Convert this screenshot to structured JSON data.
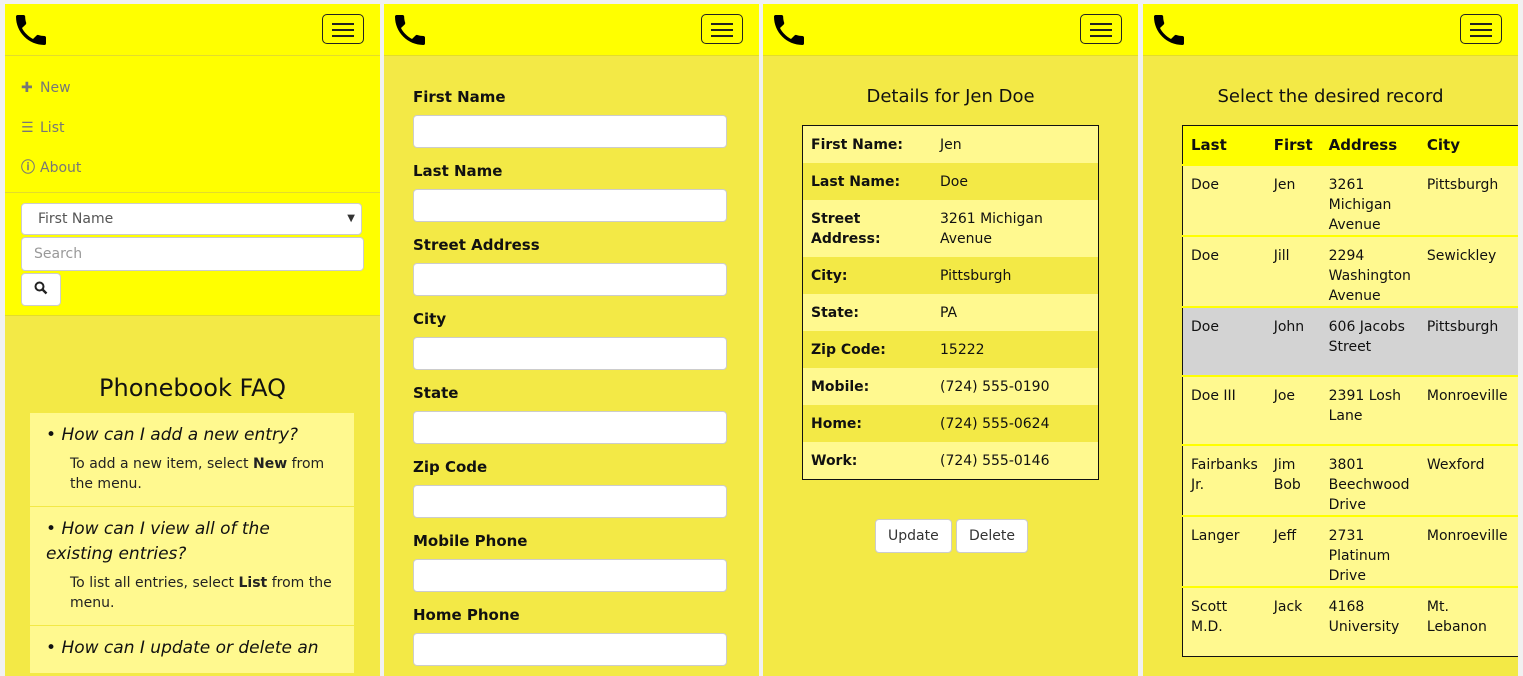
{
  "menu": {
    "items": [
      {
        "icon": "plus-icon",
        "label": "New"
      },
      {
        "icon": "list-icon",
        "label": "List"
      },
      {
        "icon": "info-icon",
        "label": "About"
      }
    ],
    "search_field": "First Name",
    "search_placeholder": "Search"
  },
  "faq": {
    "title": "Phonebook FAQ",
    "items": [
      {
        "q": "How can I add a new entry?",
        "a_pre": "To add a new item, select ",
        "a_bold": "New",
        "a_post": " from the menu."
      },
      {
        "q": "How can I view all of the existing entries?",
        "a_pre": "To list all entries, select ",
        "a_bold": "List",
        "a_post": " from the menu."
      },
      {
        "q": "How can I update or delete an"
      }
    ]
  },
  "form": {
    "labels": [
      "First Name",
      "Last Name",
      "Street Address",
      "City",
      "State",
      "Zip Code",
      "Mobile Phone",
      "Home Phone"
    ]
  },
  "details": {
    "title": "Details for Jen Doe",
    "rows": [
      {
        "k": "First Name:",
        "v": "Jen"
      },
      {
        "k": "Last Name:",
        "v": "Doe"
      },
      {
        "k": "Street Address:",
        "v": "3261 Michigan Avenue"
      },
      {
        "k": "City:",
        "v": "Pittsburgh"
      },
      {
        "k": "State:",
        "v": "PA"
      },
      {
        "k": "Zip Code:",
        "v": "15222"
      },
      {
        "k": "Mobile:",
        "v": "(724) 555-0190"
      },
      {
        "k": "Home:",
        "v": "(724) 555-0624"
      },
      {
        "k": "Work:",
        "v": "(724) 555-0146"
      }
    ],
    "update_label": "Update",
    "delete_label": "Delete"
  },
  "records": {
    "title": "Select the desired record",
    "headers": [
      "Last",
      "First",
      "Address",
      "City"
    ],
    "rows": [
      [
        "Doe",
        "Jen",
        "3261 Michigan Avenue",
        "Pittsburgh"
      ],
      [
        "Doe",
        "Jill",
        "2294 Washington Avenue",
        "Sewickley"
      ],
      [
        "Doe",
        "John",
        "606 Jacobs Street",
        "Pittsburgh"
      ],
      [
        "Doe III",
        "Joe",
        "2391 Losh Lane",
        "Monroeville"
      ],
      [
        "Fairbanks Jr.",
        "Jim Bob",
        "3801 Beechwood Drive",
        "Wexford"
      ],
      [
        "Langer",
        "Jeff",
        "2731 Platinum Drive",
        "Monroeville"
      ],
      [
        "Scott M.D.",
        "Jack",
        "4168 University",
        "Mt. Lebanon"
      ]
    ],
    "selected_index": 2
  },
  "colors": {
    "header": "#ffff00",
    "body": "#f3e946",
    "row": "#fff98f",
    "selected": "#d3d3d3"
  }
}
